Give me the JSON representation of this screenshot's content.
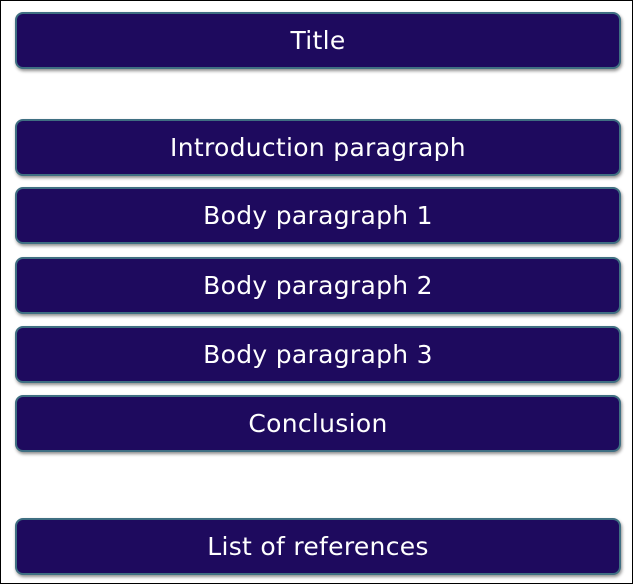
{
  "diagram": {
    "boxes": [
      {
        "id": "title",
        "label": "Title"
      },
      {
        "id": "intro",
        "label": "Introduction paragraph"
      },
      {
        "id": "body1",
        "label": "Body paragraph 1"
      },
      {
        "id": "body2",
        "label": "Body paragraph 2"
      },
      {
        "id": "body3",
        "label": "Body paragraph 3"
      },
      {
        "id": "conclusion",
        "label": "Conclusion"
      },
      {
        "id": "references",
        "label": "List of references"
      }
    ],
    "colors": {
      "box_fill": "#1e0a5e",
      "box_border": "#3f6f82",
      "text": "#ffffff",
      "frame": "#000000"
    }
  }
}
